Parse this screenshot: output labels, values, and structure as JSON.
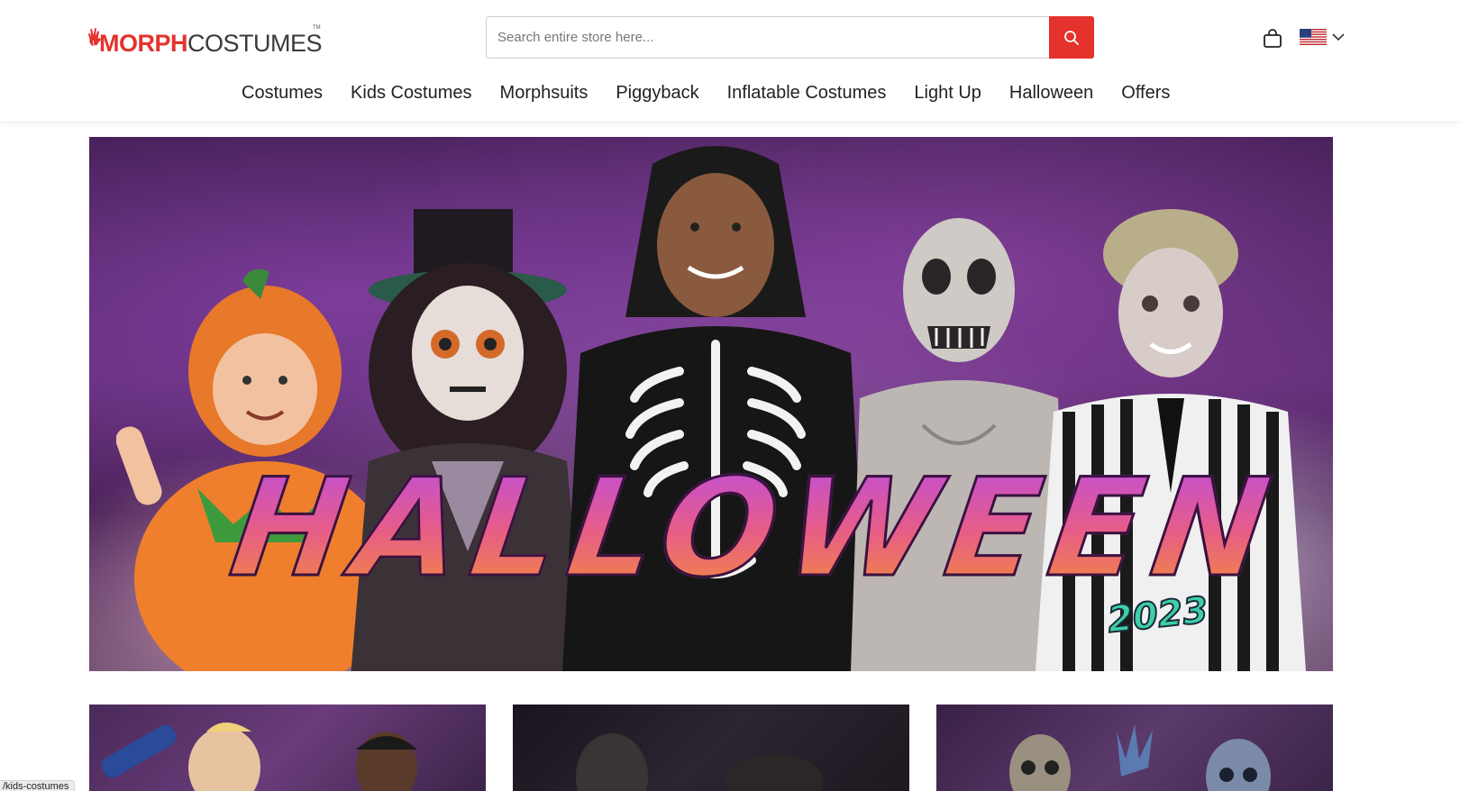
{
  "brand": {
    "logo_red": "MORPH",
    "logo_dark": "COSTUMES",
    "tm": "TM",
    "accent": "#e5322d"
  },
  "search": {
    "placeholder": "Search entire store here...",
    "value": ""
  },
  "header": {
    "cart_icon": "shopping-bag-icon",
    "locale_icon": "us-flag-icon"
  },
  "nav": {
    "items": [
      "Costumes",
      "Kids Costumes",
      "Morphsuits",
      "Piggyback",
      "Inflatable Costumes",
      "Light Up",
      "Halloween",
      "Offers"
    ]
  },
  "hero": {
    "title": "HALLOWEEN",
    "year": "2023"
  },
  "status_bar": {
    "url": "/kids-costumes"
  }
}
